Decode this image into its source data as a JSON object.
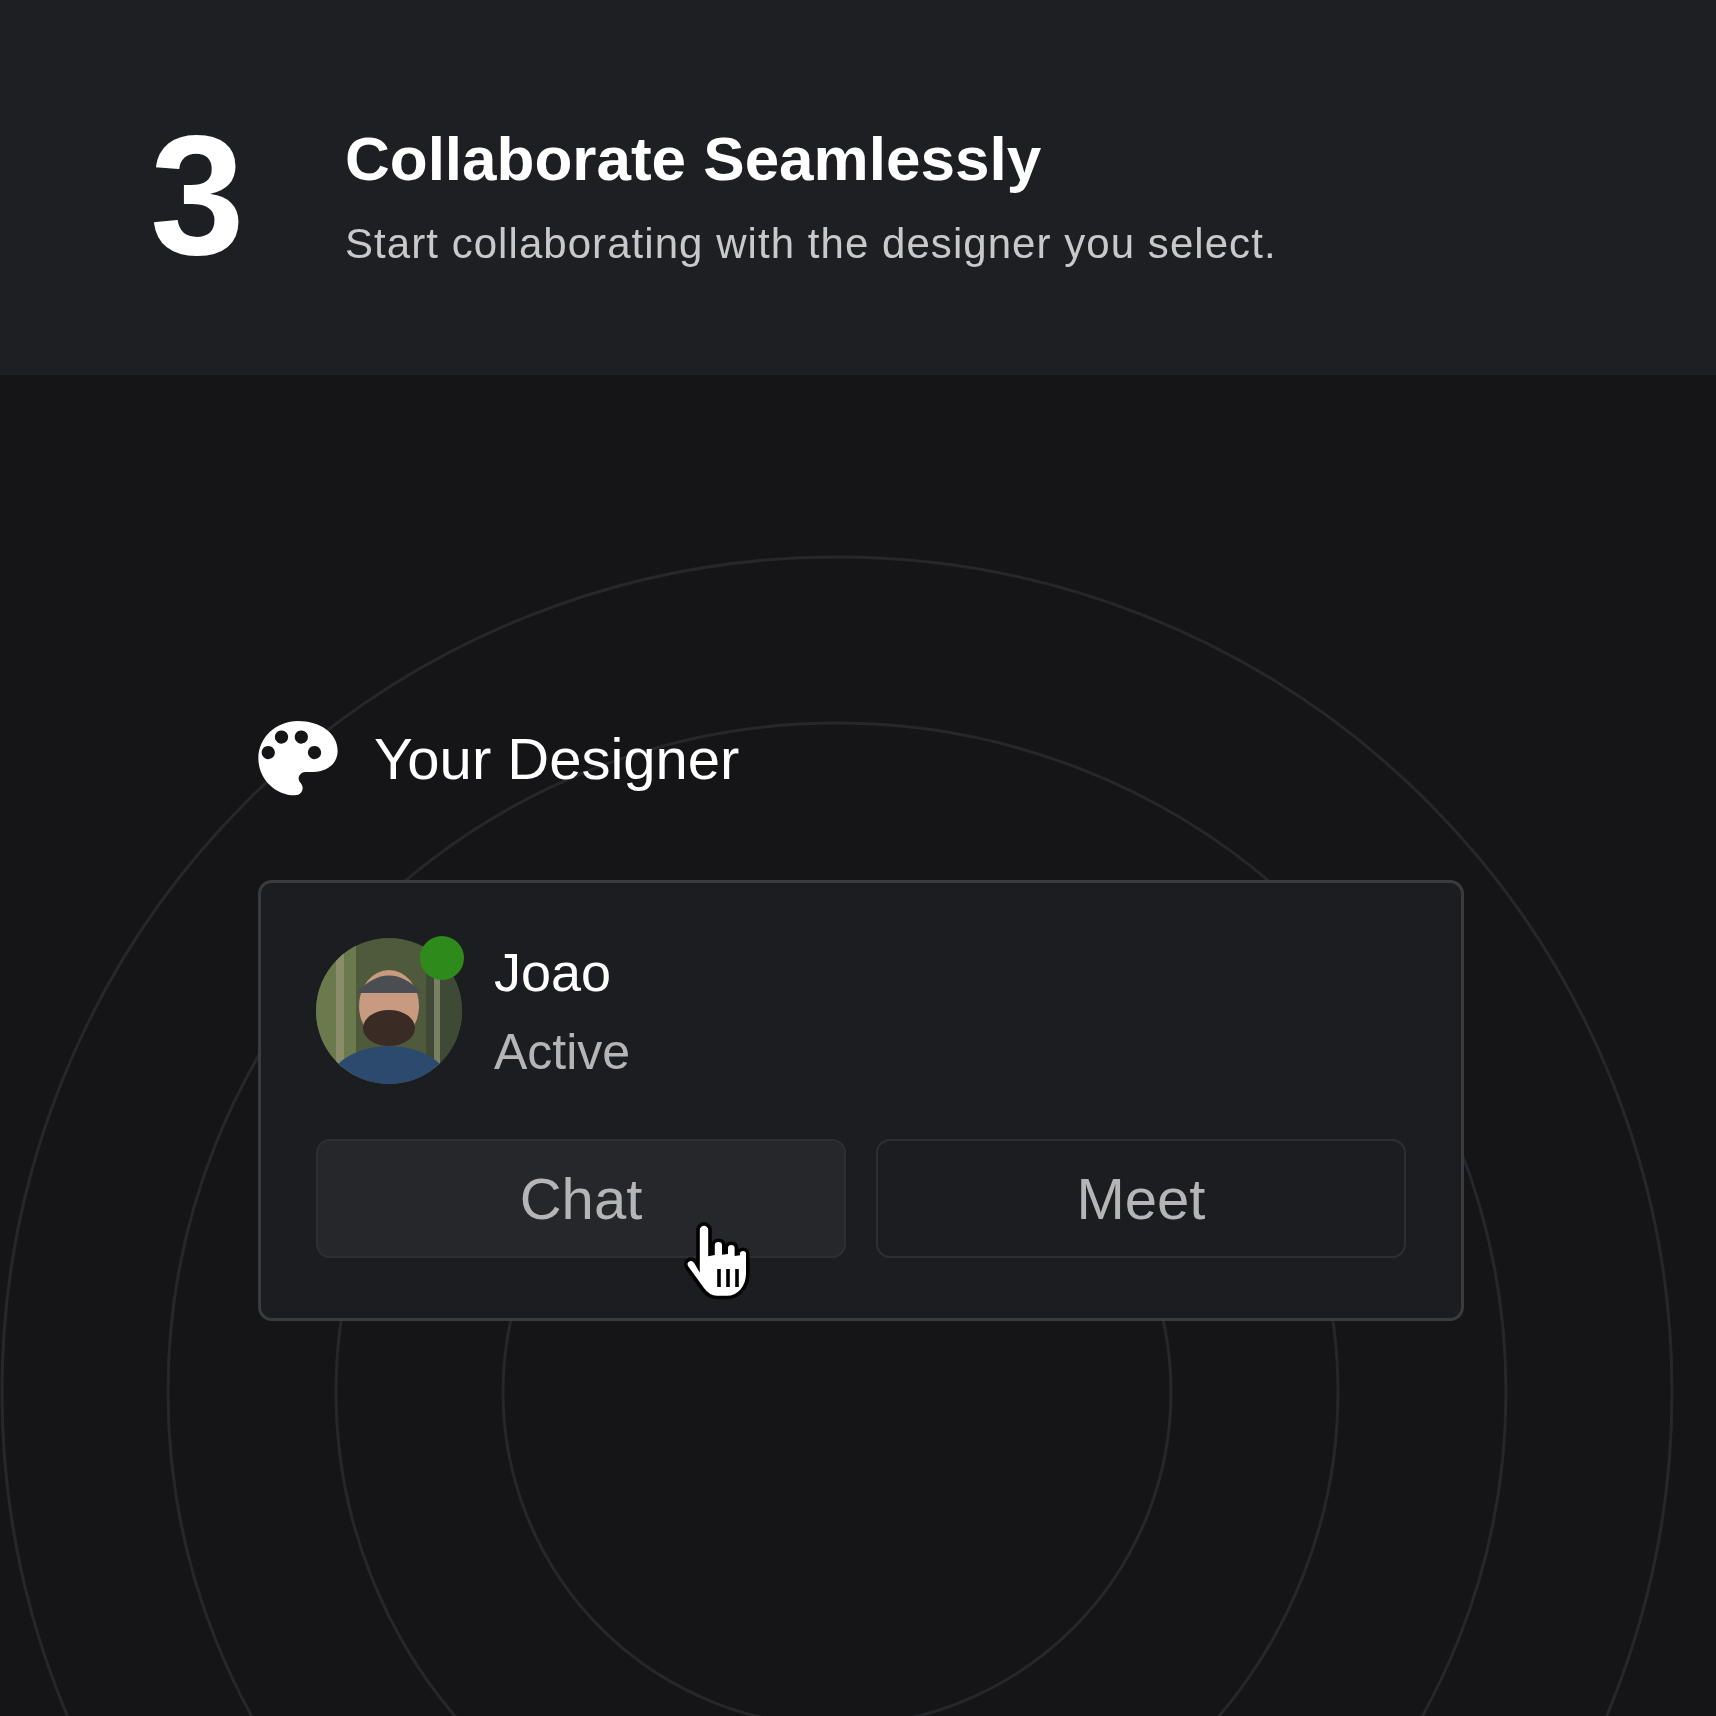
{
  "step": {
    "number": "3",
    "title": "Collaborate Seamlessly",
    "subtitle": "Start collaborating with the designer you select."
  },
  "section": {
    "title": "Your Designer"
  },
  "designer": {
    "name": "Joao",
    "status": "Active",
    "online": true
  },
  "buttons": [
    {
      "label": "Chat",
      "hovered": true
    },
    {
      "label": "Meet",
      "hovered": false
    }
  ]
}
